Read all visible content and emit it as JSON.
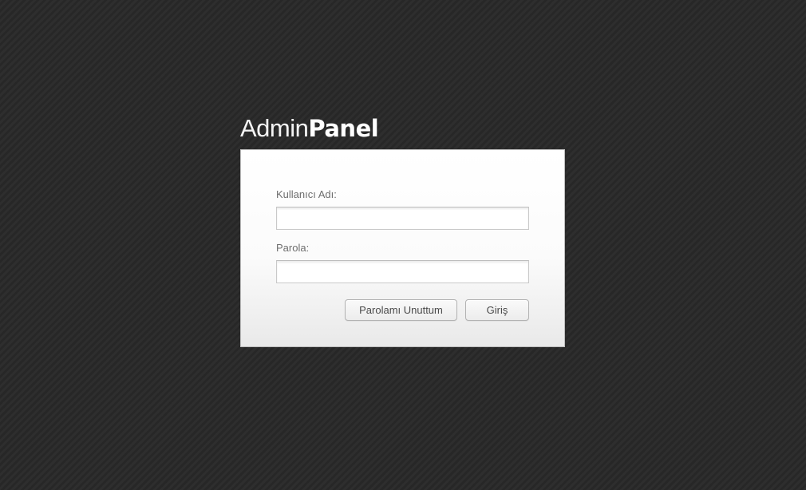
{
  "logo": {
    "light_text": "Admin",
    "bold_text": "Panel"
  },
  "login_form": {
    "username_label": "Kullanıcı Adı:",
    "username_value": "",
    "password_label": "Parola:",
    "password_value": "",
    "forgot_password_label": "Parolamı Unuttum",
    "login_button_label": "Giriş"
  },
  "colors": {
    "background": "#2b2b2b",
    "panel_background": "#ffffff",
    "label_text": "#6e6e6e",
    "button_text": "#4a4a4a"
  }
}
